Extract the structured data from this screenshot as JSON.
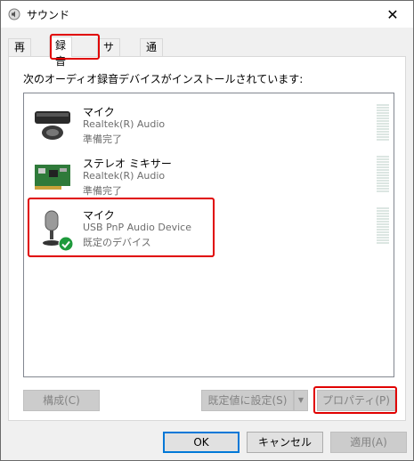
{
  "window": {
    "title": "サウンド",
    "close_glyph": "✕"
  },
  "tabs": [
    {
      "label": "再生"
    },
    {
      "label": "録音"
    },
    {
      "label": "サウンド"
    },
    {
      "label": "通信"
    }
  ],
  "panel": {
    "instructions": "次のオーディオ録音デバイスがインストールされています:",
    "devices": [
      {
        "name": "マイク",
        "description": "Realtek(R) Audio",
        "status": "準備完了",
        "icon": "webcam-mic-icon"
      },
      {
        "name": "ステレオ ミキサー",
        "description": "Realtek(R) Audio",
        "status": "準備完了",
        "icon": "sound-card-icon"
      },
      {
        "name": "マイク",
        "description": "USB PnP Audio Device",
        "status": "既定のデバイス",
        "icon": "usb-microphone-icon"
      }
    ],
    "configure_label": "構成(C)",
    "set_default_label": "既定値に設定(S)",
    "properties_label": "プロパティ(P)",
    "split_arrow": "▼"
  },
  "footer": {
    "ok_label": "OK",
    "cancel_label": "キャンセル",
    "apply_label": "適用(A)"
  },
  "colors": {
    "highlight": "#e00000",
    "accent": "#0078d7",
    "default_check": "#1e9a3c"
  }
}
